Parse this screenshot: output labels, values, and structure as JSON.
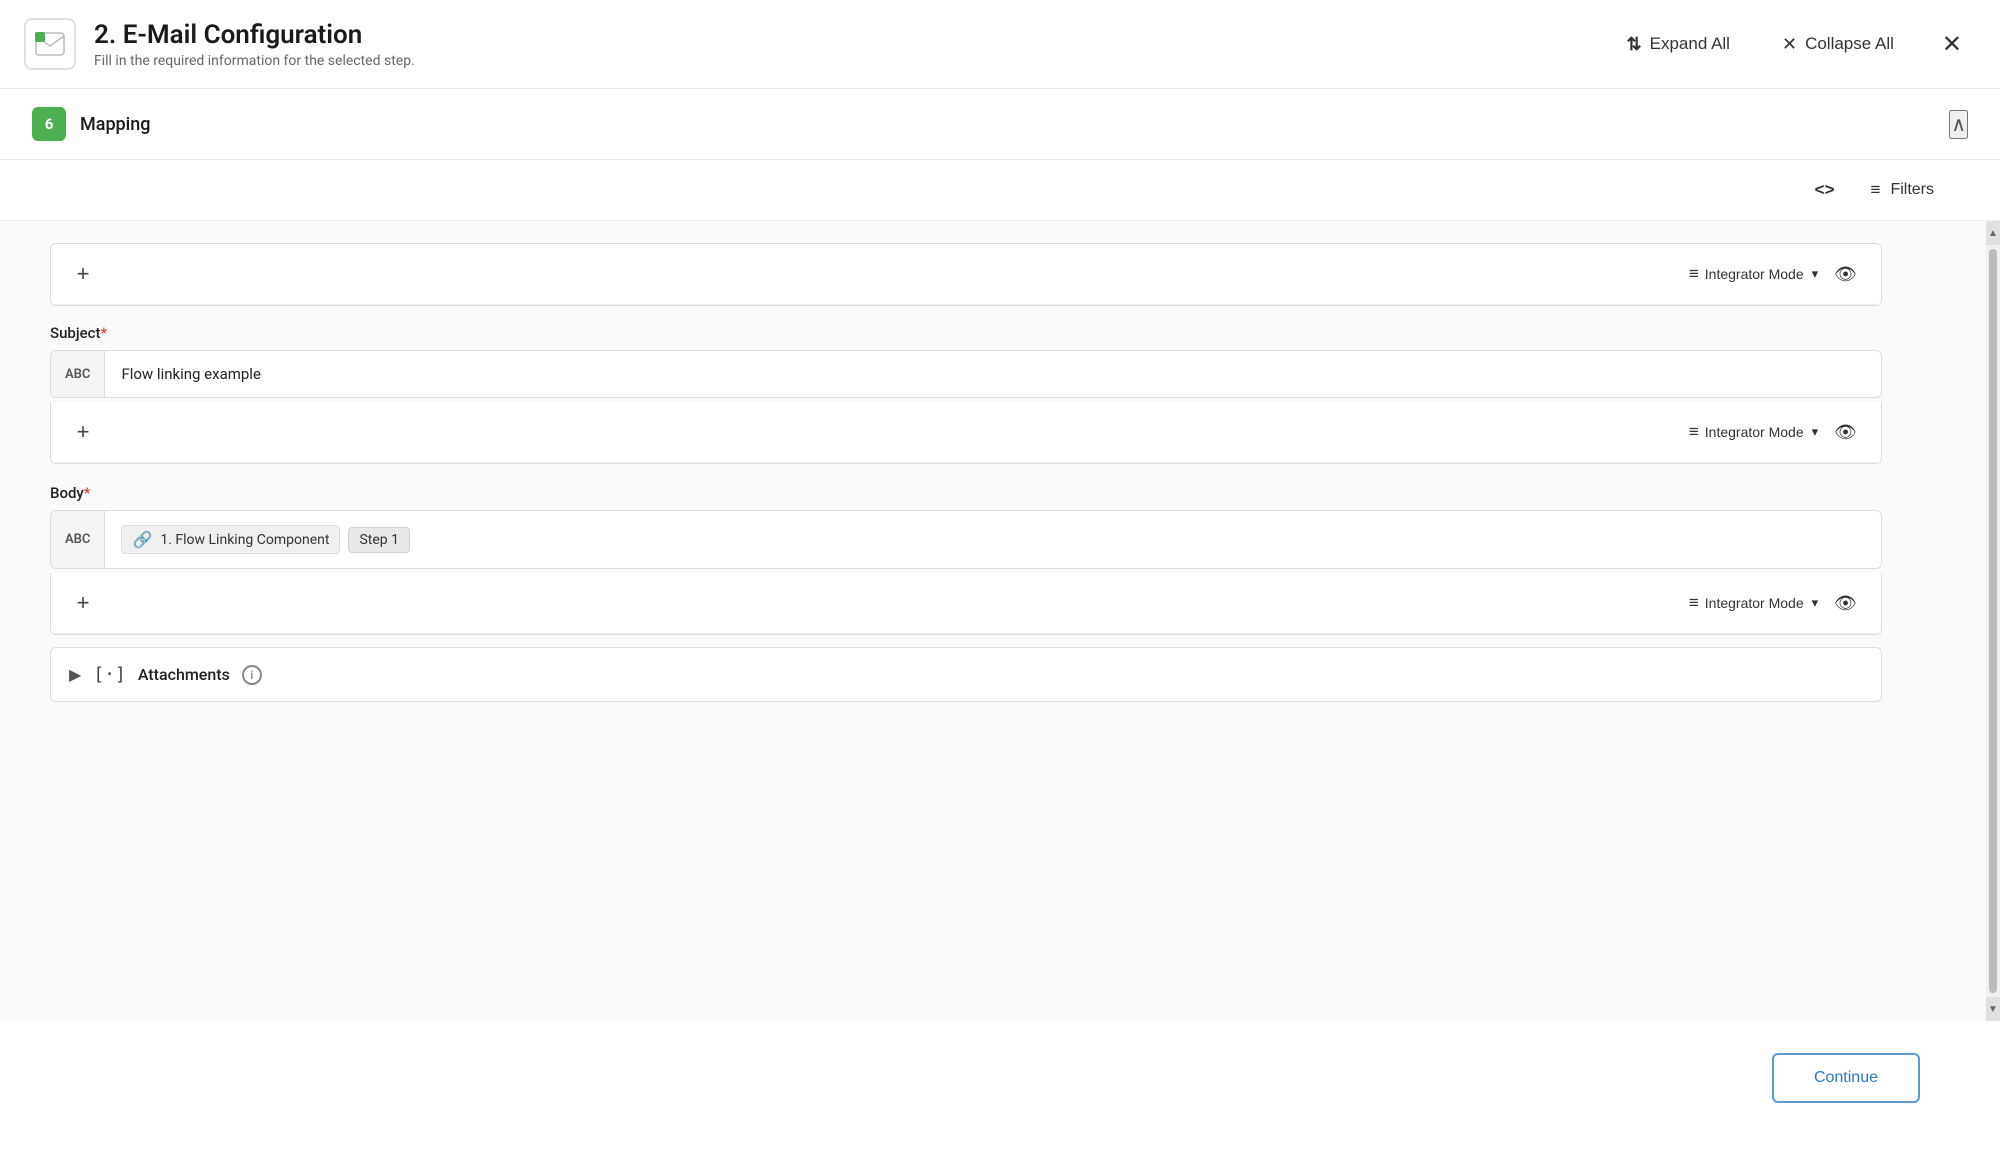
{
  "header": {
    "step_number": "2.",
    "title": "2. E-Mail Configuration",
    "subtitle": "Fill in the required information for the selected step.",
    "expand_all_label": "Expand All",
    "collapse_all_label": "Collapse All",
    "close_label": "✕"
  },
  "section": {
    "badge": "6",
    "title": "Mapping",
    "collapsed": false
  },
  "toolbar": {
    "code_icon": "<>",
    "filters_label": "Filters"
  },
  "fields": {
    "subject": {
      "label": "Subject",
      "value": "Flow linking example",
      "mode_label": "Integrator Mode",
      "add_label": "+"
    },
    "body": {
      "label": "Body",
      "link_text": "1. Flow Linking Component",
      "step_tag": "Step 1",
      "mode_label": "Integrator Mode",
      "add_label": "+"
    }
  },
  "attachments": {
    "label": "Attachments"
  },
  "continue_button": {
    "label": "Continue"
  },
  "abc_label": "ABC",
  "icons": {
    "chevron_up": "∧",
    "chevron_down": "∨",
    "eye": "👁",
    "link": "🔗",
    "info": "i",
    "expand_arrow": "▶",
    "scroll_up": "▲",
    "scroll_down": "▼"
  }
}
